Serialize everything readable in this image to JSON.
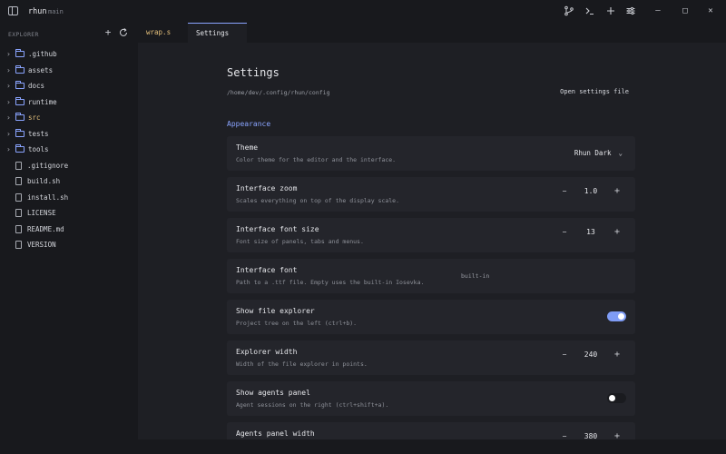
{
  "app": {
    "name": "rhun",
    "branch": "main"
  },
  "titlebar": {
    "icons": [
      "sidebar-toggle-icon",
      "git-branch-icon",
      "terminal-icon",
      "plus-icon",
      "sliders-icon"
    ],
    "window_controls": {
      "minimize": "–",
      "maximize": "□",
      "close": "✕"
    }
  },
  "sidebar": {
    "label": "EXPLORER",
    "items": [
      {
        "name": ".github",
        "type": "folder"
      },
      {
        "name": "assets",
        "type": "folder"
      },
      {
        "name": "docs",
        "type": "folder"
      },
      {
        "name": "runtime",
        "type": "folder"
      },
      {
        "name": "src",
        "type": "folder"
      },
      {
        "name": "tests",
        "type": "folder"
      },
      {
        "name": "tools",
        "type": "folder"
      },
      {
        "name": ".gitignore",
        "type": "file"
      },
      {
        "name": "build.sh",
        "type": "file"
      },
      {
        "name": "install.sh",
        "type": "file"
      },
      {
        "name": "LICENSE",
        "type": "file"
      },
      {
        "name": "README.md",
        "type": "file"
      },
      {
        "name": "VERSION",
        "type": "file"
      }
    ]
  },
  "tabs": [
    {
      "label": "wrap.s",
      "active": false
    },
    {
      "label": "Settings",
      "active": true
    }
  ],
  "settings": {
    "title": "Settings",
    "path": "/home/dev/.config/rhun/config",
    "open_label": "Open settings file",
    "section": "Appearance",
    "rows": [
      {
        "label": "Theme",
        "desc": "Color theme for the editor and the interface.",
        "control": "select",
        "value": "Rhun Dark"
      },
      {
        "label": "Interface zoom",
        "desc": "Scales everything on top of the display scale.",
        "control": "stepper",
        "value": "1.0"
      },
      {
        "label": "Interface font size",
        "desc": "Font size of panels, tabs and menus.",
        "control": "stepper",
        "value": "13"
      },
      {
        "label": "Interface font",
        "desc": "Path to a .ttf file. Empty uses the built-in Iosevka.",
        "control": "input",
        "value": "built-in"
      },
      {
        "label": "Show file explorer",
        "desc": "Project tree on the left (ctrl+b).",
        "control": "toggle",
        "on": true
      },
      {
        "label": "Explorer width",
        "desc": "Width of the file explorer in points.",
        "control": "stepper",
        "value": "240"
      },
      {
        "label": "Show agents panel",
        "desc": "Agent sessions on the right (ctrl+shift+a).",
        "control": "toggle",
        "on": false
      },
      {
        "label": "Agents panel width",
        "desc": "",
        "control": "stepper",
        "value": "380"
      }
    ]
  },
  "colors": {
    "accent": "#8aa4ff",
    "toggle_on": "#7f9cf5",
    "modified_file": "#e5c07b"
  }
}
